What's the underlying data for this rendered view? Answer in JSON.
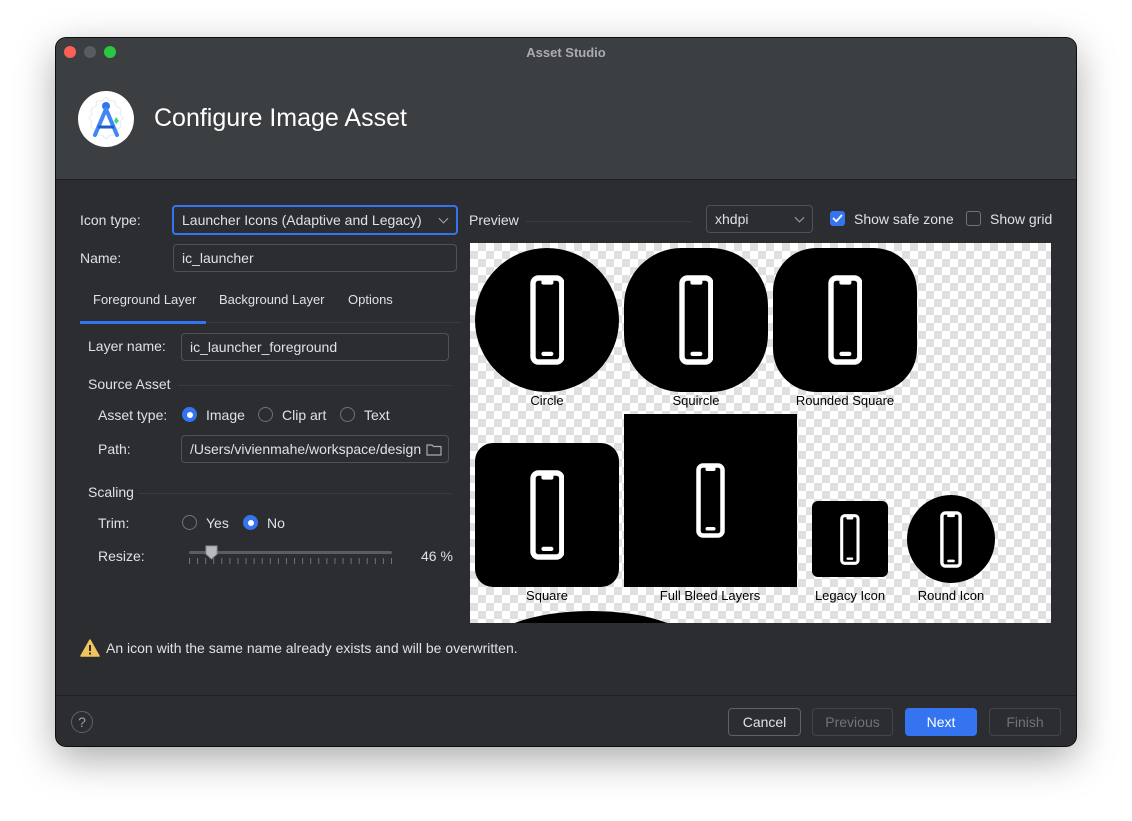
{
  "window": {
    "title": "Asset Studio"
  },
  "header": {
    "title": "Configure Image Asset",
    "logo_icon": "android-studio-asset-logo"
  },
  "form": {
    "icon_type_label": "Icon type:",
    "icon_type_value": "Launcher Icons (Adaptive and Legacy)",
    "name_label": "Name:",
    "name_value": "ic_launcher"
  },
  "tabs": [
    {
      "label": "Foreground Layer",
      "selected": true
    },
    {
      "label": "Background Layer",
      "selected": false
    },
    {
      "label": "Options",
      "selected": false
    }
  ],
  "layer": {
    "layer_name_label": "Layer name:",
    "layer_name_value": "ic_launcher_foreground",
    "source_asset_title": "Source Asset",
    "asset_type_label": "Asset type:",
    "asset_types": [
      {
        "label": "Image",
        "selected": true
      },
      {
        "label": "Clip art",
        "selected": false
      },
      {
        "label": "Text",
        "selected": false
      }
    ],
    "path_label": "Path:",
    "path_value": "/Users/vivienmahe/workspace/design",
    "scaling_title": "Scaling",
    "trim_label": "Trim:",
    "trim_options": [
      {
        "label": "Yes",
        "selected": false
      },
      {
        "label": "No",
        "selected": true
      }
    ],
    "resize_label": "Resize:",
    "resize_value": "46 %",
    "resize_percent": 46
  },
  "preview": {
    "label": "Preview",
    "density": "xhdpi",
    "show_safe_zone_label": "Show safe zone",
    "show_safe_zone": true,
    "show_grid_label": "Show grid",
    "show_grid": false,
    "captions": {
      "circle": "Circle",
      "squircle": "Squircle",
      "rounded_square": "Rounded Square",
      "square": "Square",
      "full_bleed": "Full Bleed Layers",
      "legacy": "Legacy Icon",
      "round": "Round Icon"
    },
    "icon_glyph": "smartphone-icon"
  },
  "warning": {
    "icon": "warning-icon",
    "text": "An icon with the same name already exists and will be overwritten."
  },
  "buttons": {
    "cancel": "Cancel",
    "previous": "Previous",
    "next": "Next",
    "finish": "Finish",
    "help": "?"
  },
  "colors": {
    "accent": "#3574f0",
    "window_bg": "#2b2d30",
    "header_bg": "#3c3f41",
    "warning": "#f2c55c"
  }
}
